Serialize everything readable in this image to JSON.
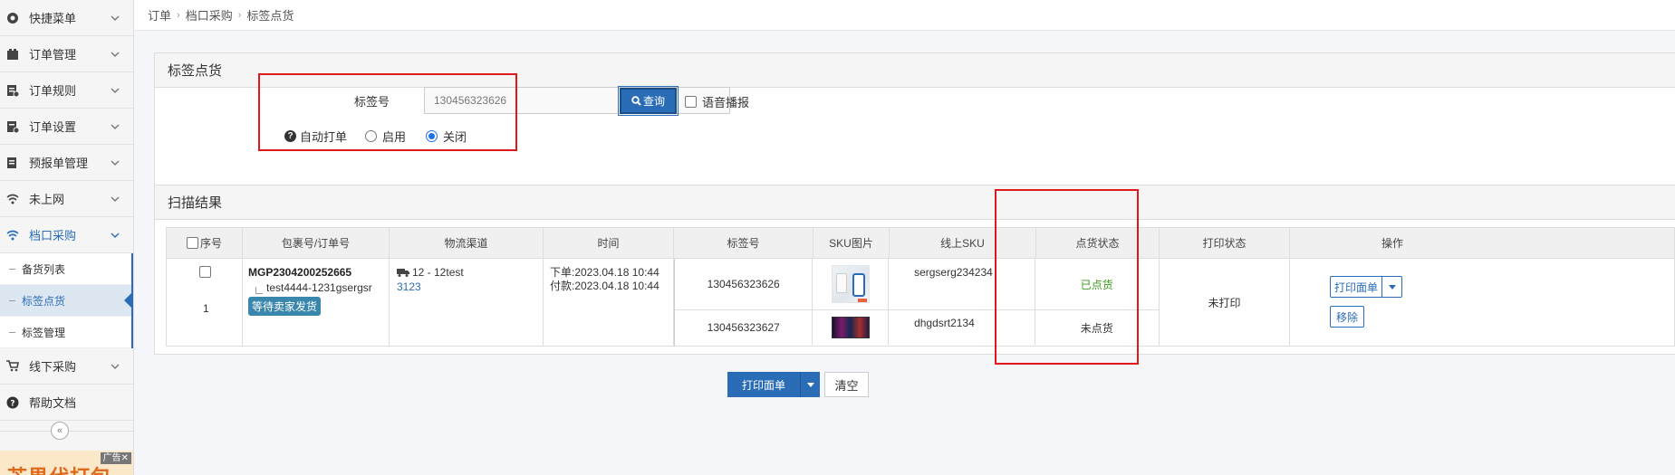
{
  "sidebar": {
    "items": [
      {
        "label": "快捷菜单",
        "icon": "settings-icon"
      },
      {
        "label": "订单管理",
        "icon": "order-icon"
      },
      {
        "label": "订单规则",
        "icon": "rules-icon"
      },
      {
        "label": "订单设置",
        "icon": "order-settings-icon"
      },
      {
        "label": "预报单管理",
        "icon": "forecast-icon"
      },
      {
        "label": "未上网",
        "icon": "wifi-icon"
      },
      {
        "label": "档口采购",
        "icon": "wifi-icon"
      }
    ],
    "sub_items": [
      "备货列表",
      "标签点货",
      "标签管理"
    ],
    "items_after": [
      {
        "label": "线下采购",
        "icon": "cart-icon"
      },
      {
        "label": "帮助文档",
        "icon": "help-icon"
      }
    ],
    "collapse_glyph": "«",
    "ad_tag": "广告✕",
    "ad_text": "芒果代打包"
  },
  "breadcrumb": [
    "订单",
    "档口采购",
    "标签点货"
  ],
  "scan_panel": {
    "title": "标签点货",
    "tag_label": "标签号",
    "tag_value": "130456323626",
    "query_label": "查询",
    "voice_label": "语音播报",
    "auto_print_label": "自动打单",
    "radio_on_label": "启用",
    "radio_off_label": "关闭",
    "auto_print_selected": "关闭"
  },
  "result_panel": {
    "title": "扫描结果",
    "headers": [
      "序号",
      "包裹号/订单号",
      "物流渠道",
      "时间",
      "标签号",
      "SKU图片",
      "线上SKU",
      "点货状态",
      "打印状态",
      "操作"
    ],
    "row": {
      "index": "1",
      "package_no": "MGP2304200252665",
      "order_no": "test4444-1231gsergsr",
      "status_badge": "等待卖家发货",
      "logistics": "12 - 12test",
      "logistics_code": "3123",
      "order_time": "下单:2023.04.18 10:44",
      "pay_time": "付款:2023.04.18 10:44",
      "print_status": "未打印",
      "print_sheet_label": "打印面单",
      "remove_label": "移除",
      "items": [
        {
          "tag_no": "130456323626",
          "online_sku": "sergserg234234",
          "check_status": "已点货",
          "status_color": "#3c9a1a"
        },
        {
          "tag_no": "130456323627",
          "online_sku": "dhgdsrt2134",
          "check_status": "未点货",
          "status_color": "#333333"
        }
      ]
    }
  },
  "footer": {
    "print_label": "打印面单",
    "clear_label": "清空"
  }
}
